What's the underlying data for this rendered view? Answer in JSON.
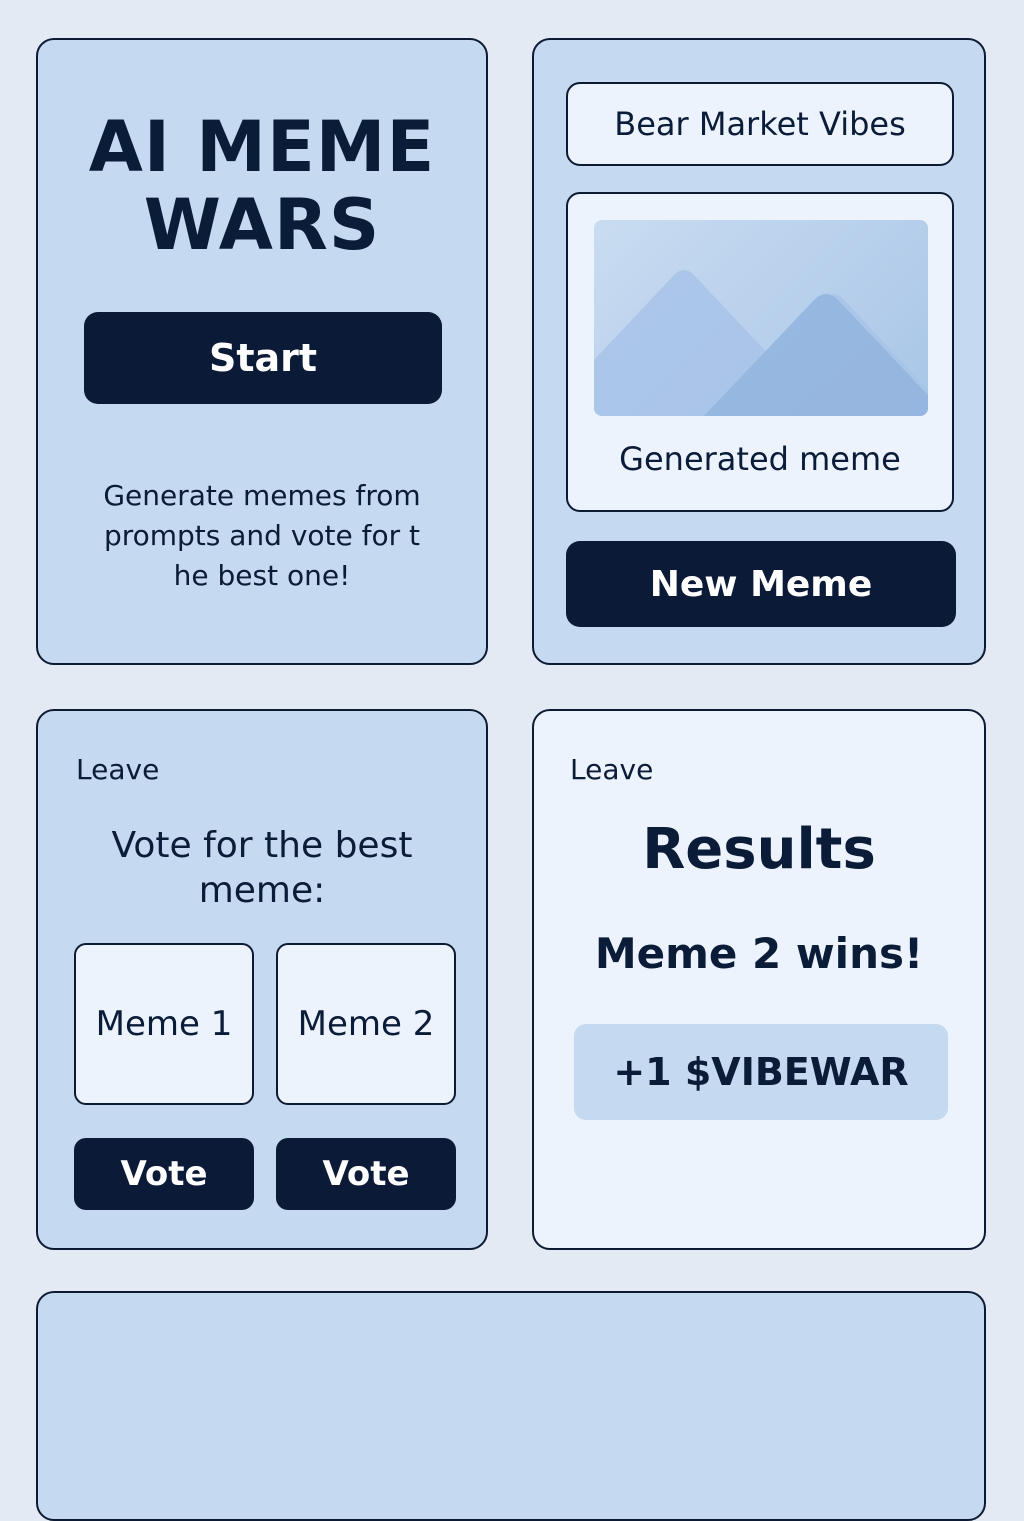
{
  "start_panel": {
    "title_line1": "AI MEME",
    "title_line2": "WARS",
    "start_label": "Start",
    "description_line1": "Generate memes from",
    "description_line2": "prompts and vote for t",
    "description_line3": "he best one!"
  },
  "generator_panel": {
    "prompt_value": "Bear Market Vibes",
    "image_icon": "mountain-image-icon",
    "caption": "Generated meme",
    "new_meme_label": "New Meme"
  },
  "vote_panel": {
    "leave_label": "Leave",
    "heading_line1": "Vote for the best",
    "heading_line2": "meme:",
    "options": [
      {
        "label": "Meme 1",
        "vote_label": "Vote"
      },
      {
        "label": "Meme 2",
        "vote_label": "Vote"
      }
    ]
  },
  "results_panel": {
    "leave_label": "Leave",
    "title": "Results",
    "winner_text": "Meme 2 wins!",
    "reward_text": "+1 $VIBEWAR"
  },
  "colors": {
    "background": "#e3eaf4",
    "panel": "#c5d9f0",
    "panel_light": "#ecf3fc",
    "button": "#0a1a37",
    "text": "#0b1c38"
  }
}
